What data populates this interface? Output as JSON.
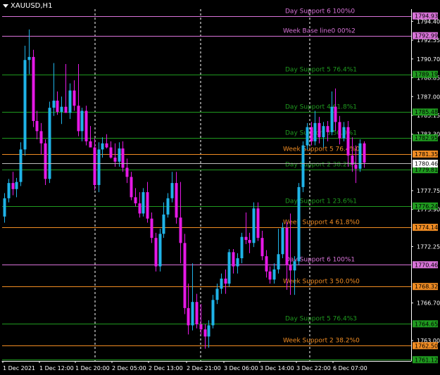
{
  "window_title": "XAUUSD,H1",
  "colors": {
    "background": "#000000",
    "bull": "#1fb3e8",
    "bear": "#e619e6",
    "axis": "#ffffff",
    "grid": "#ffffff",
    "current_price_tag_bg": "#ffffff",
    "current_price_tag_text": "#000000"
  },
  "chart_data": {
    "type": "candlestick",
    "symbol": "XAUUSD",
    "timeframe": "H1",
    "ylim": [
      1761.0,
      1795.6
    ],
    "y_ticks": [
      {
        "value": 1794.4,
        "label": "1794.40"
      },
      {
        "value": 1792.55,
        "label": "1792.55"
      },
      {
        "value": 1790.7,
        "label": "1790.70"
      },
      {
        "value": 1788.85,
        "label": "1788.85"
      },
      {
        "value": 1787.0,
        "label": "1787.00"
      },
      {
        "value": 1785.15,
        "label": "1785.15"
      },
      {
        "value": 1783.3,
        "label": "1783.30"
      },
      {
        "value": 1777.75,
        "label": "1777.75"
      },
      {
        "value": 1775.9,
        "label": "1775.90"
      },
      {
        "value": 1772.25,
        "label": "1772.25"
      },
      {
        "value": 1766.7,
        "label": "1766.70"
      },
      {
        "value": 1763.0,
        "label": "1763.00"
      }
    ],
    "x_labels": [
      "1 Dec 2021",
      "1 Dec 12:00",
      "1 Dec 20:00",
      "2 Dec 05:00",
      "2 Dec 13:00",
      "2 Dec 21:00",
      "3 Dec 06:00",
      "3 Dec 14:00",
      "3 Dec 22:00",
      "6 Dec 07:00"
    ],
    "current_price": {
      "value": 1780.46,
      "label": "1780.46"
    },
    "levels": [
      {
        "name": "Day Support 6 100%0",
        "value": 1794.93,
        "label": "1794.93",
        "color": "#d873d8"
      },
      {
        "name": "Week Base line0 00%2",
        "value": 1792.99,
        "label": "1792.99",
        "color": "#d873d8"
      },
      {
        "name": "Day Support 5 76.4%1",
        "value": 1789.19,
        "label": "1789.19",
        "color": "#1f9a1f"
      },
      {
        "name": "Day Support 4 61.8%1",
        "value": 1785.48,
        "label": "1785.48",
        "color": "#1f9a1f"
      },
      {
        "name": "Day Support 3 50.0%1",
        "value": 1782.95,
        "label": "1782.95",
        "color": "#1f9a1f"
      },
      {
        "name": "Week Support 5 76.4%0",
        "value": 1781.35,
        "label": "1781.35",
        "color": "#f08c23"
      },
      {
        "name": "Day Support 2 38.2%1",
        "value": 1779.81,
        "label": "1779.81",
        "color": "#1f9a1f"
      },
      {
        "name": "Day Support 1 23.6%1",
        "value": 1776.24,
        "label": "1776.24",
        "color": "#1f9a1f"
      },
      {
        "name": "Week Support 4 61.8%0",
        "value": 1774.14,
        "label": "1774.14",
        "color": "#f08c23"
      },
      {
        "name": "Day Support 6 100%1",
        "value": 1770.46,
        "label": "1770.46",
        "color": "#d873d8"
      },
      {
        "name": "Week Support 3 50.0%0",
        "value": 1768.32,
        "label": "1768.32",
        "color": "#f08c23"
      },
      {
        "name": "Day Support 5 76.4%3",
        "value": 1764.65,
        "label": "1764.65",
        "color": "#1f9a1f"
      },
      {
        "name": "Week Support 2 38.2%0",
        "value": 1762.5,
        "label": "1762.50",
        "color": "#f08c23"
      },
      {
        "name": "",
        "value": 1761.12,
        "label": "1761.12",
        "color": "#1f9a1f"
      }
    ],
    "candles": [
      {
        "o": 1775.2,
        "h": 1777.5,
        "l": 1774.6,
        "c": 1777.0
      },
      {
        "o": 1777.0,
        "h": 1778.9,
        "l": 1776.6,
        "c": 1778.5
      },
      {
        "o": 1778.5,
        "h": 1779.6,
        "l": 1777.3,
        "c": 1777.9
      },
      {
        "o": 1777.9,
        "h": 1779.0,
        "l": 1777.1,
        "c": 1778.6
      },
      {
        "o": 1778.6,
        "h": 1782.5,
        "l": 1778.2,
        "c": 1781.8
      },
      {
        "o": 1781.8,
        "h": 1792.0,
        "l": 1781.2,
        "c": 1790.6
      },
      {
        "o": 1790.6,
        "h": 1793.6,
        "l": 1789.2,
        "c": 1790.9
      },
      {
        "o": 1790.9,
        "h": 1791.6,
        "l": 1784.0,
        "c": 1784.6
      },
      {
        "o": 1784.6,
        "h": 1785.6,
        "l": 1782.8,
        "c": 1783.6
      },
      {
        "o": 1783.6,
        "h": 1784.4,
        "l": 1781.3,
        "c": 1782.4
      },
      {
        "o": 1782.4,
        "h": 1782.8,
        "l": 1778.3,
        "c": 1778.9
      },
      {
        "o": 1778.9,
        "h": 1786.5,
        "l": 1778.5,
        "c": 1785.9
      },
      {
        "o": 1785.9,
        "h": 1790.3,
        "l": 1785.1,
        "c": 1786.6
      },
      {
        "o": 1786.6,
        "h": 1787.5,
        "l": 1785.2,
        "c": 1785.5
      },
      {
        "o": 1785.5,
        "h": 1787.0,
        "l": 1784.3,
        "c": 1786.0
      },
      {
        "o": 1786.0,
        "h": 1790.2,
        "l": 1785.4,
        "c": 1785.4
      },
      {
        "o": 1785.4,
        "h": 1788.3,
        "l": 1784.8,
        "c": 1787.6
      },
      {
        "o": 1787.6,
        "h": 1788.6,
        "l": 1785.6,
        "c": 1786.1
      },
      {
        "o": 1786.1,
        "h": 1790.2,
        "l": 1783.1,
        "c": 1783.6
      },
      {
        "o": 1783.6,
        "h": 1785.9,
        "l": 1782.6,
        "c": 1785.6
      },
      {
        "o": 1785.6,
        "h": 1786.1,
        "l": 1782.2,
        "c": 1782.6
      },
      {
        "o": 1782.6,
        "h": 1784.1,
        "l": 1782.0,
        "c": 1782.0
      },
      {
        "o": 1782.0,
        "h": 1782.9,
        "l": 1777.8,
        "c": 1778.3
      },
      {
        "o": 1778.3,
        "h": 1782.5,
        "l": 1777.6,
        "c": 1781.8
      },
      {
        "o": 1781.8,
        "h": 1783.0,
        "l": 1781.0,
        "c": 1782.4
      },
      {
        "o": 1782.4,
        "h": 1783.3,
        "l": 1781.9,
        "c": 1782.0
      },
      {
        "o": 1782.0,
        "h": 1782.6,
        "l": 1780.9,
        "c": 1781.0
      },
      {
        "o": 1781.0,
        "h": 1782.4,
        "l": 1780.1,
        "c": 1780.6
      },
      {
        "o": 1780.6,
        "h": 1782.5,
        "l": 1780.1,
        "c": 1781.9
      },
      {
        "o": 1781.9,
        "h": 1782.6,
        "l": 1779.6,
        "c": 1780.0
      },
      {
        "o": 1780.0,
        "h": 1780.9,
        "l": 1778.5,
        "c": 1779.1
      },
      {
        "o": 1779.1,
        "h": 1779.6,
        "l": 1776.8,
        "c": 1777.1
      },
      {
        "o": 1777.1,
        "h": 1778.0,
        "l": 1776.2,
        "c": 1776.5
      },
      {
        "o": 1776.5,
        "h": 1777.6,
        "l": 1775.1,
        "c": 1775.5
      },
      {
        "o": 1775.5,
        "h": 1778.0,
        "l": 1775.2,
        "c": 1777.6
      },
      {
        "o": 1777.6,
        "h": 1778.6,
        "l": 1774.6,
        "c": 1775.0
      },
      {
        "o": 1775.0,
        "h": 1775.6,
        "l": 1772.6,
        "c": 1773.1
      },
      {
        "o": 1773.1,
        "h": 1773.6,
        "l": 1769.8,
        "c": 1770.3
      },
      {
        "o": 1770.3,
        "h": 1774.0,
        "l": 1769.8,
        "c": 1773.5
      },
      {
        "o": 1773.5,
        "h": 1776.6,
        "l": 1773.1,
        "c": 1775.4
      },
      {
        "o": 1775.4,
        "h": 1777.5,
        "l": 1775.1,
        "c": 1777.0
      },
      {
        "o": 1777.0,
        "h": 1779.6,
        "l": 1776.6,
        "c": 1778.5
      },
      {
        "o": 1778.5,
        "h": 1779.6,
        "l": 1774.5,
        "c": 1775.1
      },
      {
        "o": 1775.1,
        "h": 1778.6,
        "l": 1770.6,
        "c": 1772.6
      },
      {
        "o": 1772.6,
        "h": 1773.5,
        "l": 1765.6,
        "c": 1766.2
      },
      {
        "o": 1766.2,
        "h": 1768.6,
        "l": 1763.6,
        "c": 1764.5
      },
      {
        "o": 1764.5,
        "h": 1770.6,
        "l": 1764.0,
        "c": 1766.8
      },
      {
        "o": 1766.8,
        "h": 1767.6,
        "l": 1764.2,
        "c": 1764.6
      },
      {
        "o": 1764.6,
        "h": 1766.6,
        "l": 1763.6,
        "c": 1764.1
      },
      {
        "o": 1764.1,
        "h": 1764.6,
        "l": 1762.2,
        "c": 1763.4
      },
      {
        "o": 1763.4,
        "h": 1765.0,
        "l": 1762.3,
        "c": 1764.5
      },
      {
        "o": 1764.5,
        "h": 1767.5,
        "l": 1764.2,
        "c": 1767.0
      },
      {
        "o": 1767.0,
        "h": 1768.6,
        "l": 1766.6,
        "c": 1768.1
      },
      {
        "o": 1768.1,
        "h": 1769.6,
        "l": 1767.6,
        "c": 1769.1
      },
      {
        "o": 1769.1,
        "h": 1770.0,
        "l": 1767.6,
        "c": 1768.6
      },
      {
        "o": 1768.6,
        "h": 1772.0,
        "l": 1768.3,
        "c": 1771.7
      },
      {
        "o": 1771.7,
        "h": 1772.0,
        "l": 1769.6,
        "c": 1770.3
      },
      {
        "o": 1770.3,
        "h": 1771.6,
        "l": 1769.6,
        "c": 1771.1
      },
      {
        "o": 1771.1,
        "h": 1773.6,
        "l": 1770.6,
        "c": 1773.2
      },
      {
        "o": 1773.2,
        "h": 1775.6,
        "l": 1772.5,
        "c": 1772.9
      },
      {
        "o": 1772.9,
        "h": 1773.6,
        "l": 1771.6,
        "c": 1772.6
      },
      {
        "o": 1772.6,
        "h": 1776.6,
        "l": 1772.2,
        "c": 1776.0
      },
      {
        "o": 1776.0,
        "h": 1776.6,
        "l": 1772.8,
        "c": 1773.1
      },
      {
        "o": 1773.1,
        "h": 1773.8,
        "l": 1770.9,
        "c": 1771.3
      },
      {
        "o": 1771.3,
        "h": 1771.9,
        "l": 1769.2,
        "c": 1769.8
      },
      {
        "o": 1769.8,
        "h": 1770.3,
        "l": 1768.6,
        "c": 1769.0
      },
      {
        "o": 1769.0,
        "h": 1770.6,
        "l": 1768.6,
        "c": 1770.0
      },
      {
        "o": 1770.0,
        "h": 1774.0,
        "l": 1769.6,
        "c": 1771.5
      },
      {
        "o": 1771.5,
        "h": 1774.6,
        "l": 1771.1,
        "c": 1774.1
      },
      {
        "o": 1774.1,
        "h": 1774.7,
        "l": 1768.0,
        "c": 1770.4
      },
      {
        "o": 1770.4,
        "h": 1775.5,
        "l": 1767.5,
        "c": 1769.9
      },
      {
        "o": 1769.9,
        "h": 1771.3,
        "l": 1767.5,
        "c": 1770.8
      },
      {
        "o": 1770.8,
        "h": 1778.5,
        "l": 1770.4,
        "c": 1778.1
      },
      {
        "o": 1778.1,
        "h": 1782.6,
        "l": 1777.6,
        "c": 1782.2
      },
      {
        "o": 1782.2,
        "h": 1784.4,
        "l": 1781.8,
        "c": 1784.0
      },
      {
        "o": 1784.0,
        "h": 1784.5,
        "l": 1782.2,
        "c": 1782.6
      },
      {
        "o": 1782.6,
        "h": 1785.6,
        "l": 1782.2,
        "c": 1784.4
      },
      {
        "o": 1784.4,
        "h": 1785.0,
        "l": 1782.4,
        "c": 1783.0
      },
      {
        "o": 1783.0,
        "h": 1784.5,
        "l": 1782.0,
        "c": 1784.1
      },
      {
        "o": 1784.1,
        "h": 1784.6,
        "l": 1782.6,
        "c": 1783.5
      },
      {
        "o": 1783.5,
        "h": 1787.5,
        "l": 1783.2,
        "c": 1786.0
      },
      {
        "o": 1786.0,
        "h": 1787.8,
        "l": 1783.6,
        "c": 1784.5
      },
      {
        "o": 1784.5,
        "h": 1785.1,
        "l": 1782.3,
        "c": 1782.9
      },
      {
        "o": 1782.9,
        "h": 1784.5,
        "l": 1782.6,
        "c": 1784.0
      },
      {
        "o": 1784.0,
        "h": 1784.6,
        "l": 1780.1,
        "c": 1781.2
      },
      {
        "o": 1781.2,
        "h": 1783.0,
        "l": 1779.6,
        "c": 1780.3
      },
      {
        "o": 1780.3,
        "h": 1782.2,
        "l": 1778.5,
        "c": 1779.9
      },
      {
        "o": 1779.9,
        "h": 1782.8,
        "l": 1779.6,
        "c": 1782.4
      },
      {
        "o": 1782.4,
        "h": 1782.6,
        "l": 1780.0,
        "c": 1780.5
      }
    ]
  }
}
